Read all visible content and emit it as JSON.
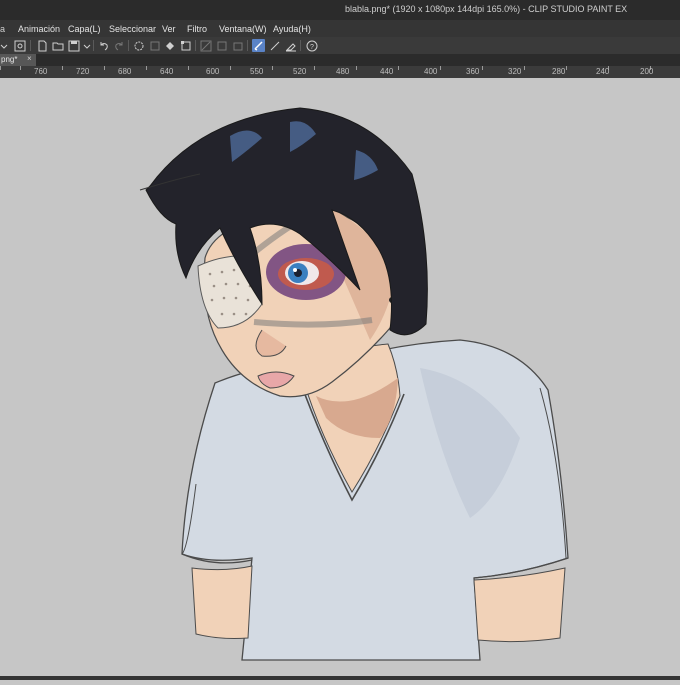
{
  "window": {
    "title": "blabla.png* (1920 x 1080px 144dpi 165.0%)  - CLIP STUDIO PAINT EX"
  },
  "menu": {
    "items": [
      "Animación",
      "Capa(L)",
      "Seleccionar",
      "Ver",
      "Filtro",
      "Ventana(W)",
      "Ayuda(H)"
    ]
  },
  "tabs": [
    {
      "label": "png*",
      "close": "×"
    }
  ],
  "ruler": {
    "labels": [
      "760",
      "720",
      "680",
      "640",
      "600",
      "550",
      "520",
      "480",
      "440",
      "400",
      "360",
      "320",
      "280",
      "240",
      "200"
    ]
  },
  "toolbar": {
    "icons": [
      "file-icon",
      "open-folder-icon",
      "save-icon",
      "undo-icon",
      "redo-icon",
      "transform-icon",
      "fill-icon",
      "selection-icon",
      "brush-icon",
      "eraser-icon",
      "help-icon"
    ]
  },
  "colors": {
    "titlebar": "#2b2b2b",
    "menubar": "#353535",
    "toolbar": "#3a3a3a",
    "canvas_background": "#c6c6c6",
    "active_tool": "#5a83c7"
  }
}
